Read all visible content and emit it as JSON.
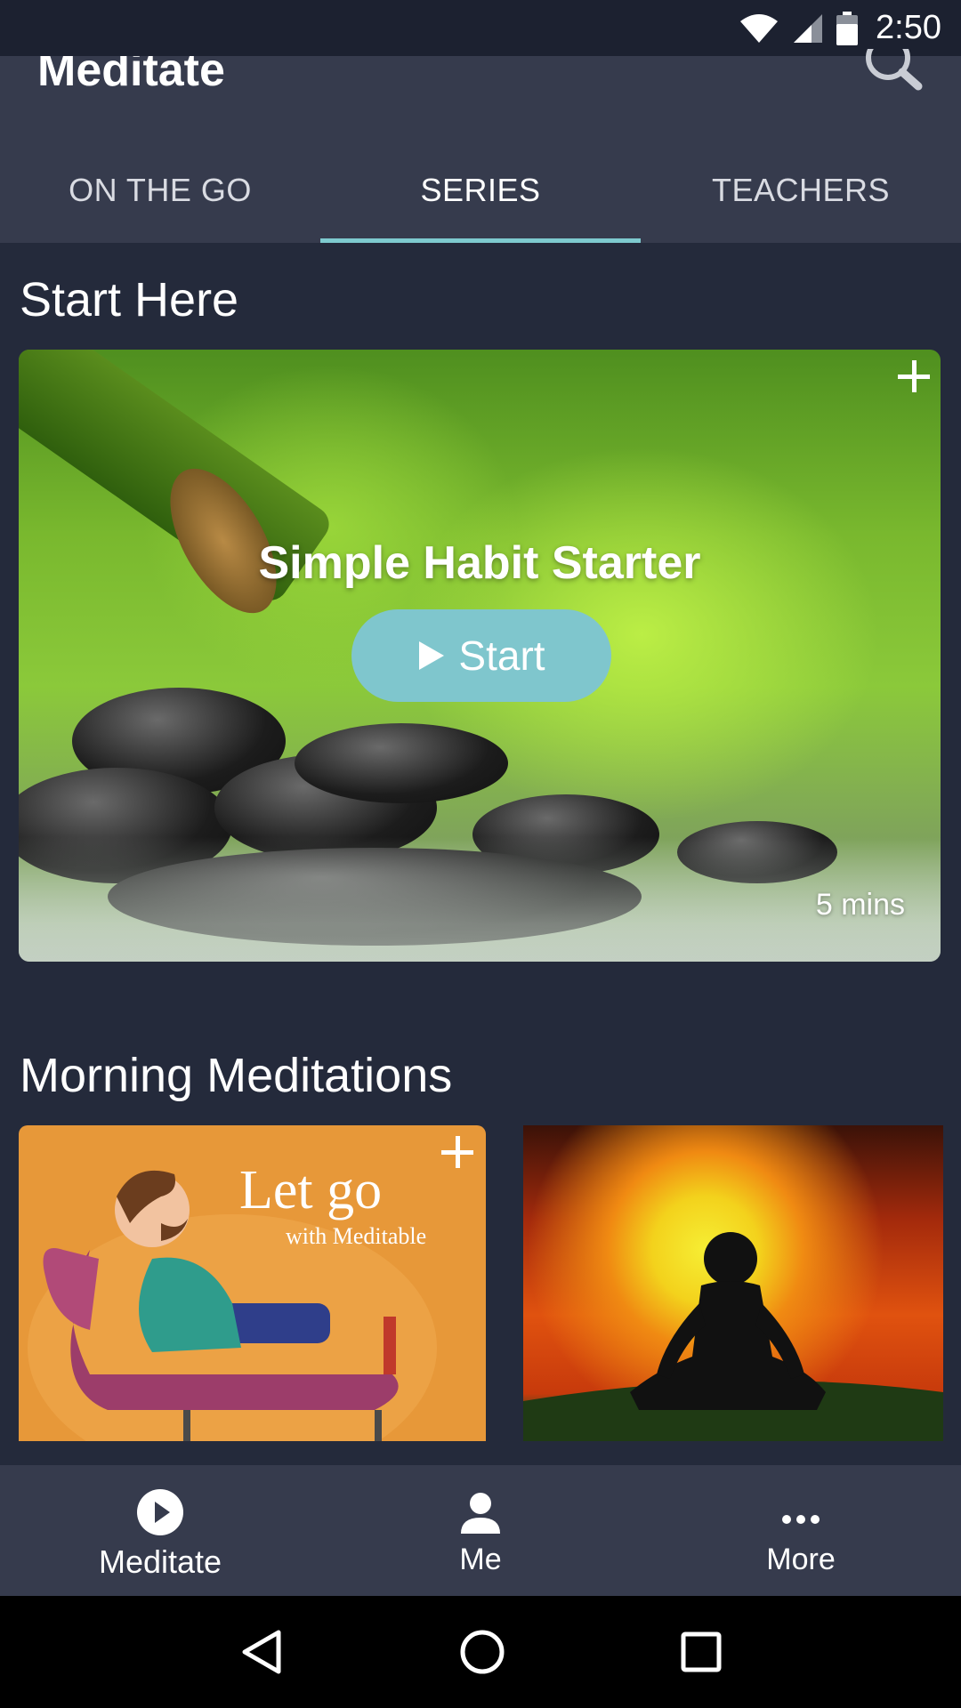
{
  "status_bar": {
    "time": "2:50"
  },
  "header": {
    "title": "Meditate",
    "tabs": [
      {
        "label": "ON THE GO",
        "active": false
      },
      {
        "label": "SERIES",
        "active": true
      },
      {
        "label": "TEACHERS",
        "active": false
      }
    ]
  },
  "sections": {
    "start_here": {
      "title": "Start Here",
      "card": {
        "title": "Simple Habit Starter",
        "start_label": "Start",
        "duration": "5 mins"
      }
    },
    "morning": {
      "title": "Morning Meditations",
      "cards": [
        {
          "title": "Let go",
          "subtitle": "with Meditable"
        },
        {
          "title": ""
        }
      ]
    }
  },
  "bottom_nav": [
    {
      "label": "Meditate",
      "icon": "play-circle-icon",
      "active": true
    },
    {
      "label": "Me",
      "icon": "person-icon",
      "active": false
    },
    {
      "label": "More",
      "icon": "more-dots-icon",
      "active": false
    }
  ],
  "colors": {
    "accent": "#7ecacf",
    "background": "#242a3b",
    "header": "#363b4d"
  }
}
